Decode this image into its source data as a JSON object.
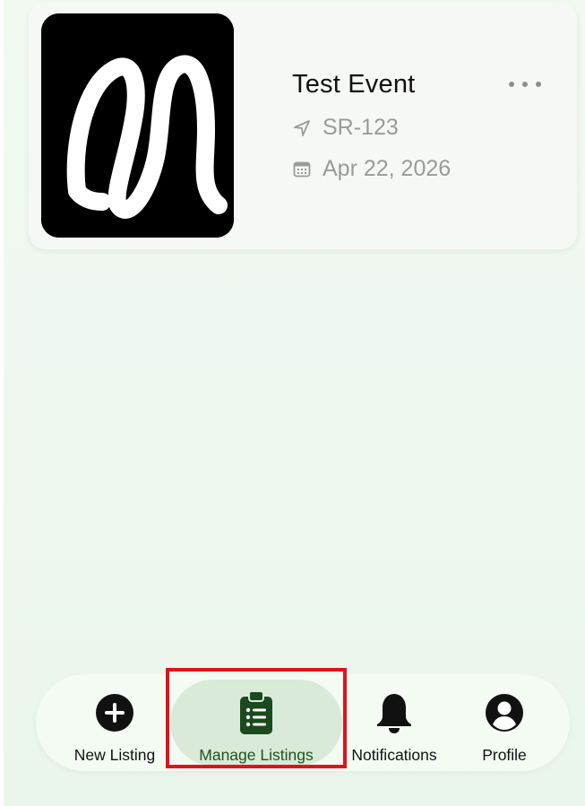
{
  "listing": {
    "title": "Test Event",
    "code": "SR-123",
    "date": "Apr 22, 2026",
    "thumbnail_icon": "brand-logo-icon",
    "more_icon": "more-icon",
    "location_icon": "location-arrow-icon",
    "date_icon": "calendar-icon"
  },
  "tabbar": {
    "active_tab": "Manage Listings",
    "tabs": [
      {
        "label": "New Listing",
        "icon": "plus-circle-icon"
      },
      {
        "label": "Manage Listings",
        "icon": "clipboard-list-icon"
      },
      {
        "label": "Notifications",
        "icon": "bell-icon"
      },
      {
        "label": "Profile",
        "icon": "profile-icon"
      }
    ]
  },
  "colors": {
    "background": "#eef8ef",
    "card": "#f6f8f6",
    "active_tab_text": "#1f5320",
    "active_tab_icon": "#1b4a1e",
    "active_pill": "#d9ead8",
    "highlight": "#e4101b",
    "meta_text": "#9a9a9a"
  }
}
